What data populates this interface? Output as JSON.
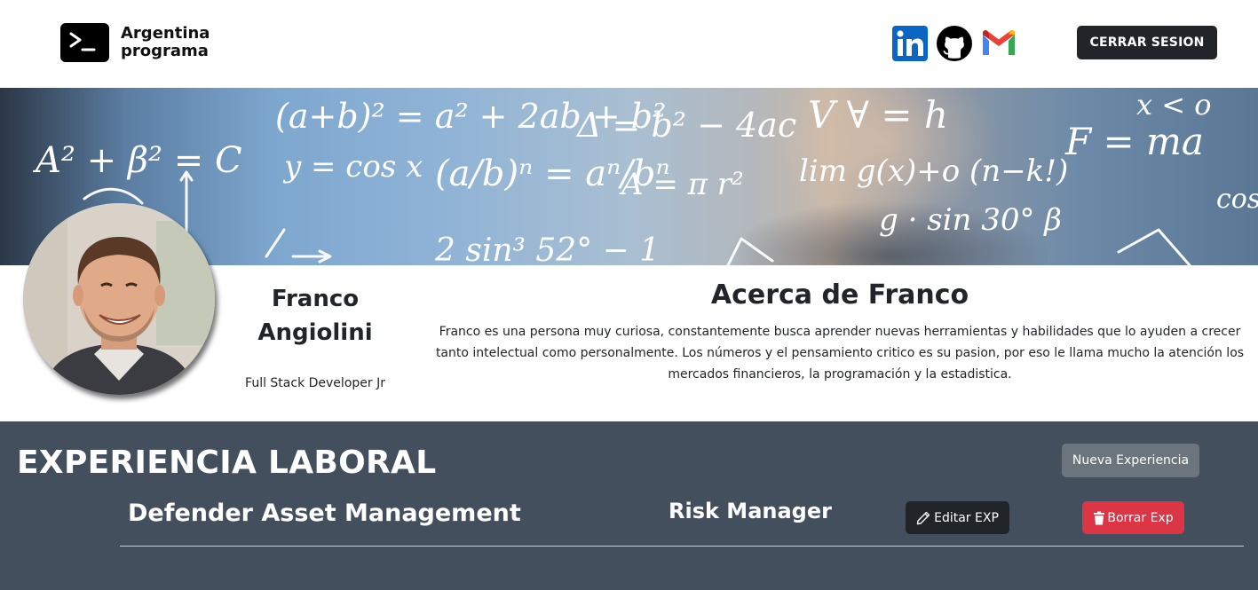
{
  "header": {
    "brand_line1": "Argentina",
    "brand_line2": "programa",
    "social": [
      {
        "name": "LinkedIn",
        "icon": "linkedin-icon",
        "color": "#0a66c2"
      },
      {
        "name": "GitHub",
        "icon": "github-icon",
        "color": "#000000"
      },
      {
        "name": "Gmail",
        "icon": "gmail-icon",
        "color": "#ea4335"
      }
    ],
    "logout_label": "CERRAR SESION"
  },
  "banner": {
    "formulas": [
      "(a+b)² = a² + 2ab + b²",
      "A² + B² = C",
      "y = cos x",
      "(a/b)ⁿ = aⁿ/bⁿ",
      "Δ = b² − 4ac",
      "A = π r²",
      "F = ma",
      "g · sin 30°",
      "lim g(x)+o (n−k!)",
      "2 sin³ 52° − 1"
    ]
  },
  "profile": {
    "first_name": "Franco",
    "last_name": "Angiolini",
    "role": "Full Stack Developer Jr"
  },
  "about": {
    "title": "Acerca de Franco",
    "text": "Franco es una persona muy curiosa, constantemente busca aprender nuevas herramientas y habilidades que lo ayuden a crecer tanto intelectual como personalmente. Los números y el pensamiento critico es su pasion, por eso le llama mucho la atención los mercados financieros, la programación y la estadistica."
  },
  "experience": {
    "title": "EXPERIENCIA LABORAL",
    "new_label": "Nueva Experiencia",
    "items": [
      {
        "company": "Defender Asset Management",
        "position": "Risk Manager",
        "edit_label": "Editar EXP",
        "delete_label": "Borrar Exp"
      }
    ]
  },
  "colors": {
    "dark_button": "#212529",
    "section_bg": "#434f5d",
    "secondary": "#6c757d",
    "danger": "#dc3545"
  }
}
